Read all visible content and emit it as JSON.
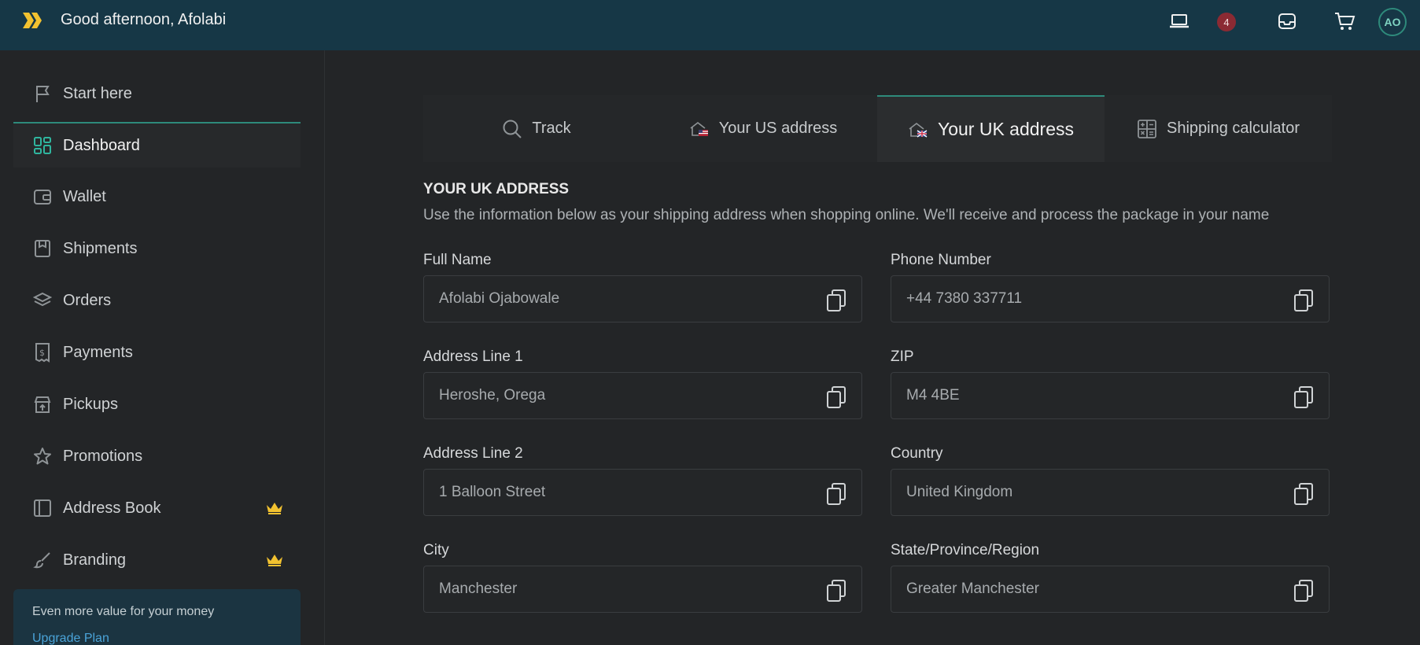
{
  "header": {
    "greeting": "Good afternoon, Afolabi",
    "notification_count": "4",
    "avatar_initials": "AO"
  },
  "sidebar": {
    "items": [
      {
        "label": "Start here",
        "icon": "flag-icon"
      },
      {
        "label": "Dashboard",
        "icon": "dashboard-icon",
        "active": true
      },
      {
        "label": "Wallet",
        "icon": "wallet-icon"
      },
      {
        "label": "Shipments",
        "icon": "box-icon"
      },
      {
        "label": "Orders",
        "icon": "layers-icon"
      },
      {
        "label": "Payments",
        "icon": "receipt-icon"
      },
      {
        "label": "Pickups",
        "icon": "store-icon"
      },
      {
        "label": "Promotions",
        "icon": "star-icon"
      },
      {
        "label": "Address Book",
        "icon": "book-icon",
        "premium": true
      },
      {
        "label": "Branding",
        "icon": "brush-icon",
        "premium": true
      }
    ],
    "upgrade": {
      "text": "Even more value for your money",
      "link": "Upgrade Plan"
    }
  },
  "tabs": [
    {
      "label": "Track",
      "icon": "search-icon"
    },
    {
      "label": "Your US address",
      "icon": "us-house-icon"
    },
    {
      "label": "Your UK address",
      "icon": "uk-house-icon",
      "active": true
    },
    {
      "label": "Shipping calculator",
      "icon": "calculator-icon"
    }
  ],
  "section": {
    "title": "YOUR UK ADDRESS",
    "description": "Use the information below as your shipping address when shopping online. We'll receive and process the package in your name"
  },
  "fields": {
    "full_name": {
      "label": "Full Name",
      "value": "Afolabi Ojabowale"
    },
    "phone": {
      "label": "Phone Number",
      "value": "+44 7380 337711"
    },
    "address1": {
      "label": "Address Line 1",
      "value": "Heroshe, Orega"
    },
    "zip": {
      "label": "ZIP",
      "value": "M4 4BE"
    },
    "address2": {
      "label": "Address Line 2",
      "value": "1 Balloon Street"
    },
    "country": {
      "label": "Country",
      "value": "United Kingdom"
    },
    "city": {
      "label": "City",
      "value": "Manchester"
    },
    "state": {
      "label": "State/Province/Region",
      "value": "Greater Manchester"
    }
  },
  "colors": {
    "topbar": "#163746",
    "accent": "#2e8a7b",
    "logo": "#f2c230",
    "crown": "#f2c230",
    "badge": "#8b2a33"
  }
}
